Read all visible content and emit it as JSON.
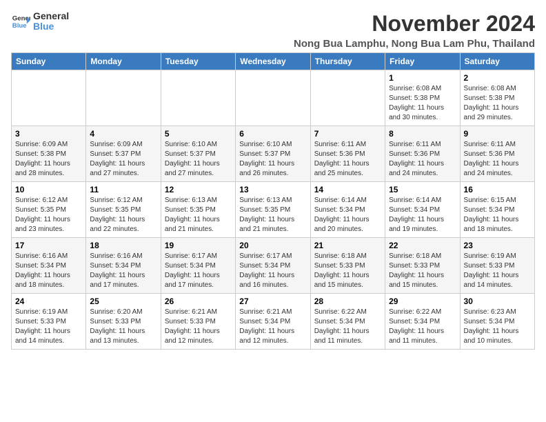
{
  "logo": {
    "general": "General",
    "blue": "Blue"
  },
  "title": "November 2024",
  "location": "Nong Bua Lamphu, Nong Bua Lam Phu, Thailand",
  "headers": [
    "Sunday",
    "Monday",
    "Tuesday",
    "Wednesday",
    "Thursday",
    "Friday",
    "Saturday"
  ],
  "weeks": [
    [
      {
        "day": "",
        "info": ""
      },
      {
        "day": "",
        "info": ""
      },
      {
        "day": "",
        "info": ""
      },
      {
        "day": "",
        "info": ""
      },
      {
        "day": "",
        "info": ""
      },
      {
        "day": "1",
        "info": "Sunrise: 6:08 AM\nSunset: 5:38 PM\nDaylight: 11 hours and 30 minutes."
      },
      {
        "day": "2",
        "info": "Sunrise: 6:08 AM\nSunset: 5:38 PM\nDaylight: 11 hours and 29 minutes."
      }
    ],
    [
      {
        "day": "3",
        "info": "Sunrise: 6:09 AM\nSunset: 5:38 PM\nDaylight: 11 hours and 28 minutes."
      },
      {
        "day": "4",
        "info": "Sunrise: 6:09 AM\nSunset: 5:37 PM\nDaylight: 11 hours and 27 minutes."
      },
      {
        "day": "5",
        "info": "Sunrise: 6:10 AM\nSunset: 5:37 PM\nDaylight: 11 hours and 27 minutes."
      },
      {
        "day": "6",
        "info": "Sunrise: 6:10 AM\nSunset: 5:37 PM\nDaylight: 11 hours and 26 minutes."
      },
      {
        "day": "7",
        "info": "Sunrise: 6:11 AM\nSunset: 5:36 PM\nDaylight: 11 hours and 25 minutes."
      },
      {
        "day": "8",
        "info": "Sunrise: 6:11 AM\nSunset: 5:36 PM\nDaylight: 11 hours and 24 minutes."
      },
      {
        "day": "9",
        "info": "Sunrise: 6:11 AM\nSunset: 5:36 PM\nDaylight: 11 hours and 24 minutes."
      }
    ],
    [
      {
        "day": "10",
        "info": "Sunrise: 6:12 AM\nSunset: 5:35 PM\nDaylight: 11 hours and 23 minutes."
      },
      {
        "day": "11",
        "info": "Sunrise: 6:12 AM\nSunset: 5:35 PM\nDaylight: 11 hours and 22 minutes."
      },
      {
        "day": "12",
        "info": "Sunrise: 6:13 AM\nSunset: 5:35 PM\nDaylight: 11 hours and 21 minutes."
      },
      {
        "day": "13",
        "info": "Sunrise: 6:13 AM\nSunset: 5:35 PM\nDaylight: 11 hours and 21 minutes."
      },
      {
        "day": "14",
        "info": "Sunrise: 6:14 AM\nSunset: 5:34 PM\nDaylight: 11 hours and 20 minutes."
      },
      {
        "day": "15",
        "info": "Sunrise: 6:14 AM\nSunset: 5:34 PM\nDaylight: 11 hours and 19 minutes."
      },
      {
        "day": "16",
        "info": "Sunrise: 6:15 AM\nSunset: 5:34 PM\nDaylight: 11 hours and 18 minutes."
      }
    ],
    [
      {
        "day": "17",
        "info": "Sunrise: 6:16 AM\nSunset: 5:34 PM\nDaylight: 11 hours and 18 minutes."
      },
      {
        "day": "18",
        "info": "Sunrise: 6:16 AM\nSunset: 5:34 PM\nDaylight: 11 hours and 17 minutes."
      },
      {
        "day": "19",
        "info": "Sunrise: 6:17 AM\nSunset: 5:34 PM\nDaylight: 11 hours and 17 minutes."
      },
      {
        "day": "20",
        "info": "Sunrise: 6:17 AM\nSunset: 5:34 PM\nDaylight: 11 hours and 16 minutes."
      },
      {
        "day": "21",
        "info": "Sunrise: 6:18 AM\nSunset: 5:33 PM\nDaylight: 11 hours and 15 minutes."
      },
      {
        "day": "22",
        "info": "Sunrise: 6:18 AM\nSunset: 5:33 PM\nDaylight: 11 hours and 15 minutes."
      },
      {
        "day": "23",
        "info": "Sunrise: 6:19 AM\nSunset: 5:33 PM\nDaylight: 11 hours and 14 minutes."
      }
    ],
    [
      {
        "day": "24",
        "info": "Sunrise: 6:19 AM\nSunset: 5:33 PM\nDaylight: 11 hours and 14 minutes."
      },
      {
        "day": "25",
        "info": "Sunrise: 6:20 AM\nSunset: 5:33 PM\nDaylight: 11 hours and 13 minutes."
      },
      {
        "day": "26",
        "info": "Sunrise: 6:21 AM\nSunset: 5:33 PM\nDaylight: 11 hours and 12 minutes."
      },
      {
        "day": "27",
        "info": "Sunrise: 6:21 AM\nSunset: 5:34 PM\nDaylight: 11 hours and 12 minutes."
      },
      {
        "day": "28",
        "info": "Sunrise: 6:22 AM\nSunset: 5:34 PM\nDaylight: 11 hours and 11 minutes."
      },
      {
        "day": "29",
        "info": "Sunrise: 6:22 AM\nSunset: 5:34 PM\nDaylight: 11 hours and 11 minutes."
      },
      {
        "day": "30",
        "info": "Sunrise: 6:23 AM\nSunset: 5:34 PM\nDaylight: 11 hours and 10 minutes."
      }
    ]
  ]
}
